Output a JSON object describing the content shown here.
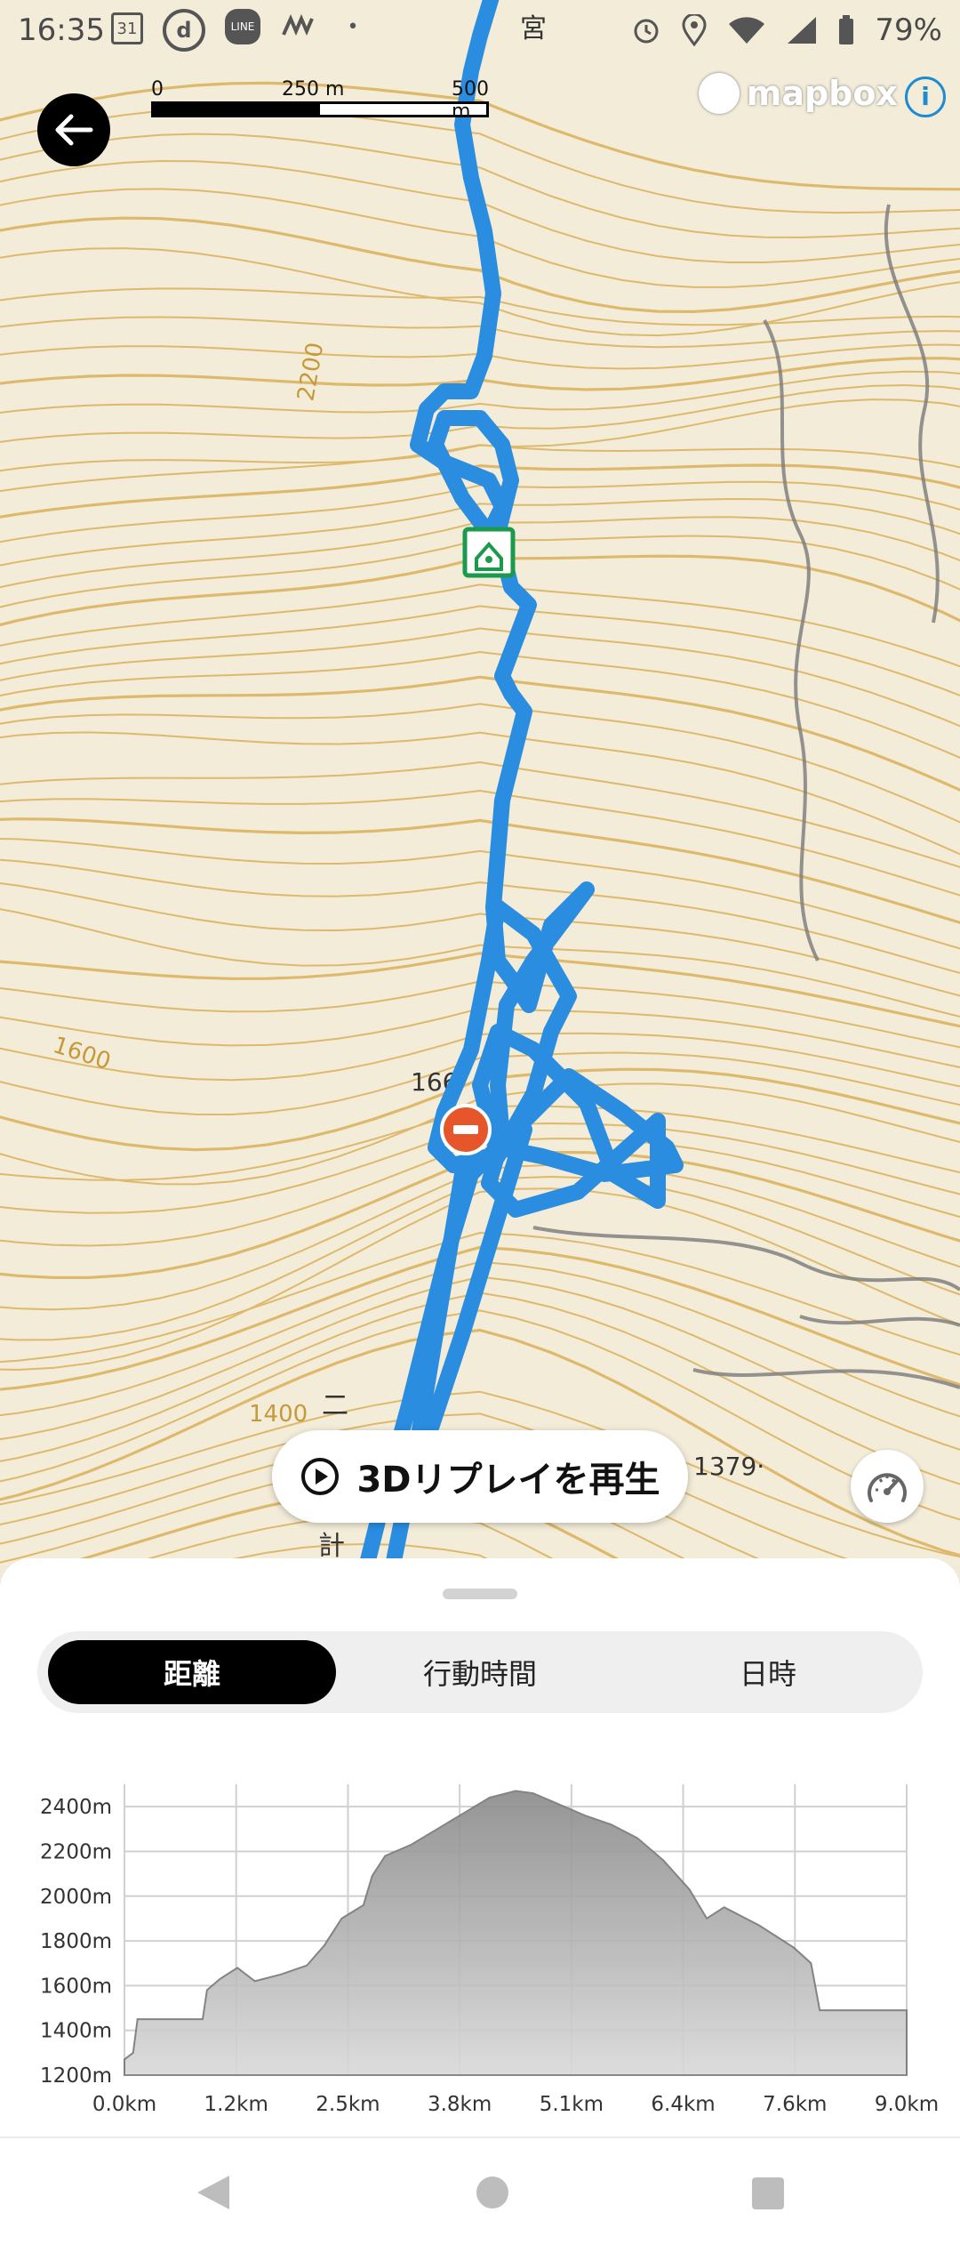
{
  "status_bar": {
    "time": "16:35",
    "battery": "79%",
    "left_icons": [
      "calendar-icon",
      "d-app-icon",
      "line-icon",
      "weather-icon",
      "dot-icon"
    ],
    "right_icons": [
      "alarm-icon",
      "location-icon",
      "wifi-icon",
      "signal-icon",
      "battery-icon"
    ],
    "calendar_day": "31",
    "d_app_label": "d",
    "line_label": "LINE"
  },
  "map": {
    "scale_labels": [
      "0",
      "250 m",
      "500 m"
    ],
    "brand": "mapbox",
    "info_label": "i",
    "labels": [
      "166",
      "1379·",
      "1600",
      "1400",
      "2200",
      "二",
      "計",
      "宮"
    ],
    "route_color": "#2a8de0"
  },
  "replay_button": {
    "label": "3Dリプレイを再生"
  },
  "tabs": {
    "items": [
      "距離",
      "行動時間",
      "日時"
    ],
    "active_index": 0
  },
  "chart_data": {
    "type": "area",
    "title": "",
    "xlabel": "",
    "ylabel": "",
    "x_tick_labels": [
      "0.0km",
      "1.2km",
      "2.5km",
      "3.8km",
      "5.1km",
      "6.4km",
      "7.6km",
      "9.0km"
    ],
    "y_tick_labels": [
      "2400m",
      "2200m",
      "2000m",
      "1800m",
      "1600m",
      "1400m",
      "1200m"
    ],
    "xlim": [
      0,
      9.0
    ],
    "ylim": [
      1200,
      2500
    ],
    "grid": true,
    "series": [
      {
        "x": [
          0.0,
          0.1,
          0.15,
          0.9,
          0.95,
          1.1,
          1.3,
          1.5,
          1.8,
          2.1,
          2.3,
          2.5,
          2.75,
          2.85,
          3.0,
          3.3,
          3.6,
          3.9,
          4.2,
          4.5,
          4.7,
          5.0,
          5.3,
          5.6,
          5.9,
          6.2,
          6.5,
          6.7,
          6.9,
          7.1,
          7.3,
          7.5,
          7.7,
          7.9,
          8.0,
          8.1,
          8.3,
          8.6,
          9.0
        ],
        "y": [
          1270,
          1300,
          1450,
          1450,
          1580,
          1630,
          1680,
          1620,
          1650,
          1690,
          1780,
          1900,
          1960,
          2090,
          2180,
          2230,
          2300,
          2370,
          2440,
          2470,
          2460,
          2410,
          2360,
          2320,
          2260,
          2160,
          2030,
          1900,
          1950,
          1910,
          1870,
          1820,
          1770,
          1700,
          1490,
          1490,
          1490,
          1490,
          1490
        ]
      }
    ]
  }
}
